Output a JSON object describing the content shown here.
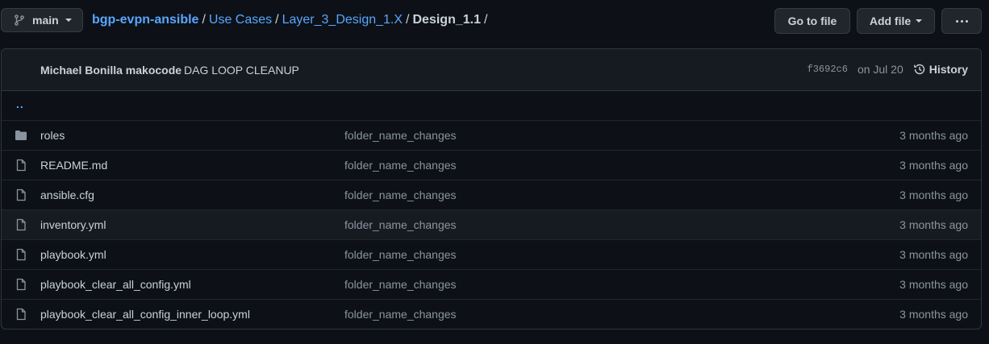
{
  "branch": {
    "name": "main"
  },
  "breadcrumb": {
    "repo": "bgp-evpn-ansible",
    "parts": [
      "Use Cases",
      "Layer_3_Design_1.X"
    ],
    "current": "Design_1.1",
    "separator": "/"
  },
  "actions": {
    "go_to_file": "Go to file",
    "add_file": "Add file"
  },
  "commit": {
    "author": "Michael Bonilla makocode",
    "message": "DAG LOOP CLEANUP",
    "sha": "f3692c6",
    "date": "on Jul 20",
    "history_label": "History"
  },
  "parent_dir": "..",
  "files": [
    {
      "type": "folder",
      "name": "roles",
      "message": "folder_name_changes",
      "time": "3 months ago"
    },
    {
      "type": "file",
      "name": "README.md",
      "message": "folder_name_changes",
      "time": "3 months ago"
    },
    {
      "type": "file",
      "name": "ansible.cfg",
      "message": "folder_name_changes",
      "time": "3 months ago"
    },
    {
      "type": "file",
      "name": "inventory.yml",
      "message": "folder_name_changes",
      "time": "3 months ago"
    },
    {
      "type": "file",
      "name": "playbook.yml",
      "message": "folder_name_changes",
      "time": "3 months ago"
    },
    {
      "type": "file",
      "name": "playbook_clear_all_config.yml",
      "message": "folder_name_changes",
      "time": "3 months ago"
    },
    {
      "type": "file",
      "name": "playbook_clear_all_config_inner_loop.yml",
      "message": "folder_name_changes",
      "time": "3 months ago"
    }
  ],
  "colors": {
    "background": "#0d1117",
    "link": "#58a6ff",
    "muted": "#8b949e",
    "border": "#30363d"
  }
}
